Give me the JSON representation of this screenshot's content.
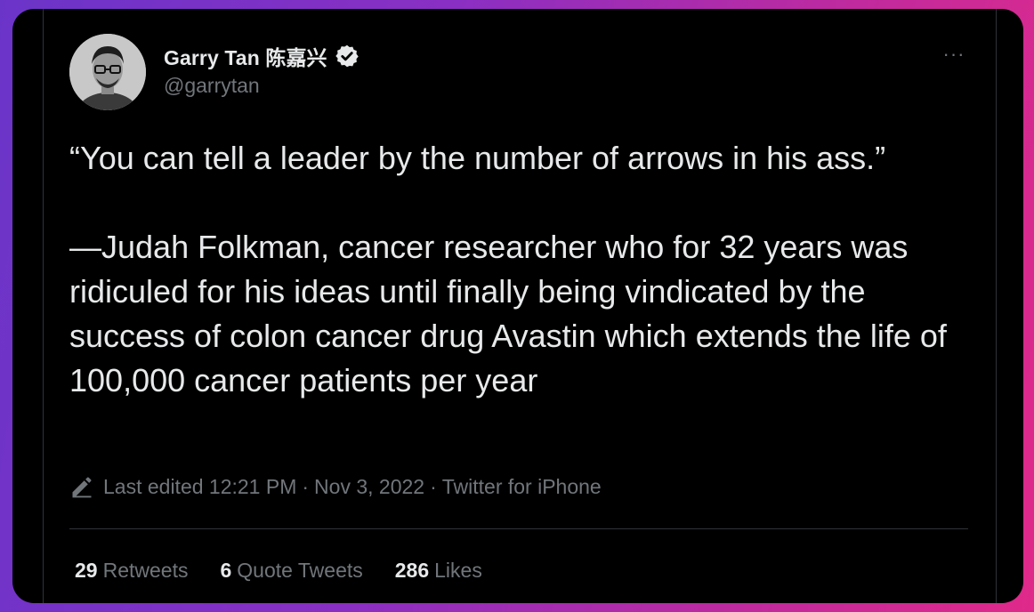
{
  "author": {
    "display_name": "Garry Tan 陈嘉兴",
    "handle": "@garrytan",
    "verified_icon": "verified-badge-icon",
    "avatar_icon": "profile-photo"
  },
  "menu": {
    "more_label": "···"
  },
  "tweet": {
    "paragraphs": [
      "“You can tell a leader by the number of arrows in his ass.”",
      "—Judah Folkman, cancer researcher who for 32 years was ridiculed for his ideas until finally being vindicated by the success of colon cancer drug Avastin which extends the life of 100,000 cancer patients per year"
    ]
  },
  "meta": {
    "edited_label": "Last edited 12:21 PM",
    "date": "Nov 3, 2022",
    "source": "Twitter for iPhone",
    "separator": "·"
  },
  "stats": {
    "retweets_count": "29",
    "retweets_label": "Retweets",
    "quotes_count": "6",
    "quotes_label": "Quote Tweets",
    "likes_count": "286",
    "likes_label": "Likes"
  },
  "colors": {
    "card_bg": "#000000",
    "primary_text": "#e7e9ea",
    "secondary_text": "#71767b",
    "divider": "#2f3336",
    "verified": "#e7e9ea"
  }
}
